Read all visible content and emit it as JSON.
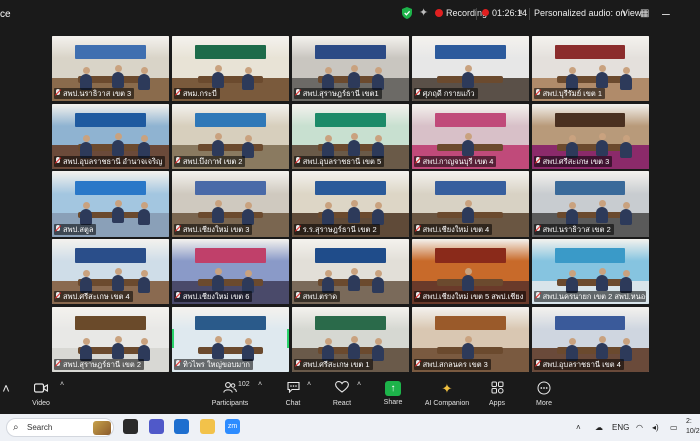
{
  "meeting": {
    "window_title": "ce",
    "recording_label": "Recording",
    "timer": "01:26:14",
    "audio_status": "Personalized audio: on",
    "view_label": "View"
  },
  "tiles": [
    {
      "label": "สพป.นราธิวาส เขต 3",
      "wall": "#d9d4c8",
      "banner": "#3f6fb0",
      "floor": "#8a6b4c"
    },
    {
      "label": "สพม.กระบี่",
      "wall": "#e8e3d6",
      "banner": "#1d6b4a",
      "floor": "#7a5a3c"
    },
    {
      "label": "สพป.สุราษฎร์ธานี เขต1",
      "wall": "#c9c6c0",
      "banner": "#2b4a85",
      "floor": "#6c6a66"
    },
    {
      "label": "ศุภฤดี กรายแก้ว",
      "wall": "#e7e7e7",
      "banner": "#2c5a9c",
      "floor": "#5a5048"
    },
    {
      "label": "สพป.บุรีรัมย์ เขต 1",
      "wall": "#e4e0dc",
      "banner": "#8b2c2c",
      "floor": "#b08b6a"
    },
    {
      "label": "สพป.อุบลราชธานี อำนาจเจริญ",
      "wall": "#8fb3d1",
      "banner": "#1e5aa0",
      "floor": "#6b4a3a"
    },
    {
      "label": "สพป.บึงกาฬ เขต 2",
      "wall": "#d7cfbd",
      "banner": "#2f78b8",
      "floor": "#8a7a60"
    },
    {
      "label": "สพป.อุบลราชธานี เขต 5",
      "wall": "#c8e0d0",
      "banner": "#1c8a68",
      "floor": "#6a5a48"
    },
    {
      "label": "สพป.กาญจนบุรี เขต 4",
      "wall": "#d8c0c8",
      "banner": "#c04a7a",
      "floor": "#c04a7a"
    },
    {
      "label": "สพป.ศรีสะเกษ เขต 3",
      "wall": "#b89a7a",
      "banner": "#4a3020",
      "floor": "#8b2a6a"
    },
    {
      "label": "สพป.สตูล",
      "wall": "#a3c6e0",
      "banner": "#2a78c8",
      "floor": "#8aa0b8"
    },
    {
      "label": "สพป.เชียงใหม่ เขต 3",
      "wall": "#cfc9bf",
      "banner": "#4a6aa8",
      "floor": "#7a6650"
    },
    {
      "label": "ร.ร.สุราษฎร์ธานี เขต 2",
      "wall": "#ddd6c6",
      "banner": "#2a5a9a",
      "floor": "#5f4a38"
    },
    {
      "label": "สพป.เชียงใหม่ เขต 4",
      "wall": "#d8d2c4",
      "banner": "#375f9e",
      "floor": "#6a5642"
    },
    {
      "label": "สพป.นราธิวาส เขต 2",
      "wall": "#c8ccd0",
      "banner": "#3a6a9a",
      "floor": "#5a5a5a"
    },
    {
      "label": "สพป.ศรีสะเกษ เขต 4",
      "wall": "#cfdde8",
      "banner": "#2a4e8a",
      "floor": "#8a6a50"
    },
    {
      "label": "สพป.เชียงใหม่ เขต 6",
      "wall": "#8a9ac8",
      "banner": "#c0406a",
      "floor": "#4a4a6a"
    },
    {
      "label": "สพป.ตราด",
      "wall": "#e2dfd8",
      "banner": "#1f4c8a",
      "floor": "#7a6a5a"
    },
    {
      "label": "สพป.เชียงใหม่ เขต 5 สพป.เชียง",
      "wall": "#c86a2a",
      "banner": "#8a2a1a",
      "floor": "#6a3a2a"
    },
    {
      "label": "สพป.นครนายก เขต 2 สพป.หนองบัวลำภู",
      "wall": "#86c4e0",
      "banner": "#3a9ac8",
      "floor": "#d8e4ea"
    },
    {
      "label": "สพป.สุราษฎร์ธานี เขต 2",
      "wall": "#e8e8e6",
      "banner": "#6a4a2a",
      "floor": "#d8d8d4"
    },
    {
      "label": "ทิวไพร ใหญ่ขอบมาก",
      "wall": "#dfe9ef",
      "banner": "#2a5a8a",
      "floor": "#dfe9ef"
    },
    {
      "label": "สพป.ศรีสะเกษ เขต 1",
      "wall": "#d6d8d2",
      "banner": "#2a6a4a",
      "floor": "#6a5a4a"
    },
    {
      "label": "สพป.สกลนคร เขต 3",
      "wall": "#d9c7b2",
      "banner": "#9a5a2a",
      "floor": "#7a5a40"
    },
    {
      "label": "สพป.อุบลราชธานี เขต 4",
      "wall": "#cfd6e0",
      "banner": "#3a5a9a",
      "floor": "#6a4a3a"
    }
  ],
  "toolbar": {
    "video": "Video",
    "participants": "Participants",
    "participants_count": "102",
    "chat": "Chat",
    "react": "React",
    "share": "Share",
    "ai_companion": "AI Companion",
    "apps": "Apps",
    "more": "More"
  },
  "taskbar": {
    "search_placeholder": "Search",
    "lang": "ENG",
    "time": "2:",
    "date": "10/2"
  },
  "colors": {
    "recording": "#e02020",
    "share_green": "#1db34a",
    "speaker_outline": "#2ad36b",
    "shield_green": "#1db34a"
  },
  "icons": {
    "shield": "shield-check-icon",
    "sparkle": "sparkle-icon",
    "pause": "pause-icon",
    "view": "grid-view-icon"
  }
}
